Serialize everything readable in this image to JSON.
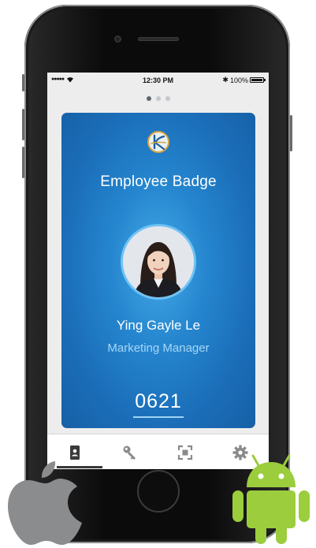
{
  "status_bar": {
    "signal": "●●●●●",
    "time": "12:30 PM",
    "bluetooth": "✱",
    "battery_text": "100%"
  },
  "pager": {
    "pages": 3,
    "active": 0
  },
  "badge": {
    "title": "Employee Badge",
    "name": "Ying Gayle Le",
    "role": "Marketing Manager",
    "number": "0621",
    "colors": {
      "card_center": "#46a9e6",
      "card_edge": "#1660a6",
      "role_text": "#a6d7f6"
    }
  },
  "tabs": [
    {
      "icon": "badge-icon",
      "active": true
    },
    {
      "icon": "key-icon",
      "active": false
    },
    {
      "icon": "scan-icon",
      "active": false
    },
    {
      "icon": "gear-icon",
      "active": false
    }
  ],
  "platform_logos": [
    {
      "icon": "apple-logo-icon",
      "color": "#8a8c8e"
    },
    {
      "icon": "android-robot-icon",
      "color": "#9bcd3c"
    }
  ]
}
